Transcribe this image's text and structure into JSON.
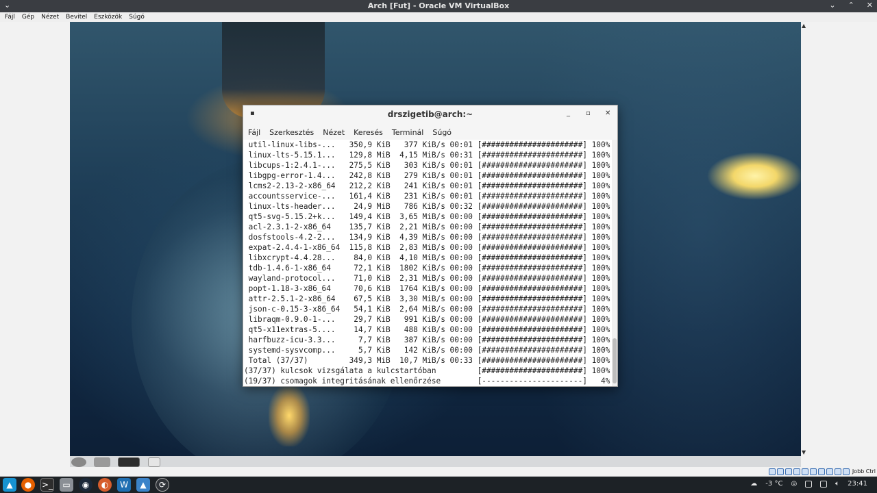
{
  "host": {
    "window_title": "Arch [Fut] - Oracle VM VirtualBox",
    "menu": [
      "Fájl",
      "Gép",
      "Nézet",
      "Bevitel",
      "Eszközök",
      "Súgó"
    ],
    "host_key": "Jobb Ctrl"
  },
  "terminal": {
    "title": "drszigetib@arch:~",
    "menu": [
      "Fájl",
      "Szerkesztés",
      "Nézet",
      "Keresés",
      "Terminál",
      "Súgó"
    ],
    "lines": [
      " util-linux-libs-...   350,9 KiB   377 KiB/s 00:01 [######################] 100%",
      " linux-lts-5.15.1...   129,8 MiB  4,15 MiB/s 00:31 [######################] 100%",
      " libcups-1:2.4.1-...   275,5 KiB   303 KiB/s 00:01 [######################] 100%",
      " libgpg-error-1.4...   242,8 KiB   279 KiB/s 00:01 [######################] 100%",
      " lcms2-2.13-2-x86_64   212,2 KiB   241 KiB/s 00:01 [######################] 100%",
      " accountsservice-...   161,4 KiB   231 KiB/s 00:01 [######################] 100%",
      " linux-lts-header...    24,9 MiB   786 KiB/s 00:32 [######################] 100%",
      " qt5-svg-5.15.2+k...   149,4 KiB  3,65 MiB/s 00:00 [######################] 100%",
      " acl-2.3.1-2-x86_64    135,7 KiB  2,21 MiB/s 00:00 [######################] 100%",
      " dosfstools-4.2-2...   134,9 KiB  4,39 MiB/s 00:00 [######################] 100%",
      " expat-2.4.4-1-x86_64  115,8 KiB  2,83 MiB/s 00:00 [######################] 100%",
      " libxcrypt-4.4.28...    84,0 KiB  4,10 MiB/s 00:00 [######################] 100%",
      " tdb-1.4.6-1-x86_64     72,1 KiB  1802 KiB/s 00:00 [######################] 100%",
      " wayland-protocol...    71,0 KiB  2,31 MiB/s 00:00 [######################] 100%",
      " popt-1.18-3-x86_64     70,6 KiB  1764 KiB/s 00:00 [######################] 100%",
      " attr-2.5.1-2-x86_64    67,5 KiB  3,30 MiB/s 00:00 [######################] 100%",
      " json-c-0.15-3-x86_64   54,1 KiB  2,64 MiB/s 00:00 [######################] 100%",
      " libraqm-0.9.0-1-...    29,7 KiB   991 KiB/s 00:00 [######################] 100%",
      " qt5-x11extras-5....    14,7 KiB   488 KiB/s 00:00 [######################] 100%",
      " harfbuzz-icu-3.3...     7,7 KiB   387 KiB/s 00:00 [######################] 100%",
      " systemd-sysvcomp...     5,7 KiB   142 KiB/s 00:00 [######################] 100%",
      " Total (37/37)         349,3 MiB  10,7 MiB/s 00:33 [######################] 100%",
      "(37/37) kulcsok vizsgálata a kulcstartóban         [######################] 100%",
      "(19/37) csomagok integritásának ellenőrzése        [----------------------]   4%"
    ]
  },
  "taskbar": {
    "weather": "-3 °C",
    "clock": "23:41"
  },
  "colors": {
    "host_bar": "#1d2226",
    "terminal_bg": "#ffffff",
    "terminal_text": "#222222"
  }
}
